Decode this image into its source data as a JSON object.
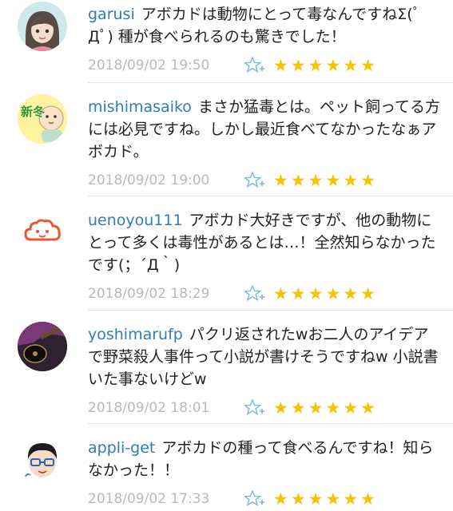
{
  "comments": [
    {
      "username": "garusi",
      "text": "アボカドは動物にとって毒なんですねΣ(ﾟДﾟ) 種が食べられるのも驚きでした！",
      "date": "2018/09/02 19:50",
      "stars": "★★★★★★"
    },
    {
      "username": "mishimasaiko",
      "text": "まさか猛毒とは。ペット飼ってる方には必見ですね。しかし最近食べてなかったなぁアボカド。",
      "date": "2018/09/02 19:00",
      "stars": "★★★★★★",
      "avatar_text": "新冬"
    },
    {
      "username": "uenoyou111",
      "text": "アボカド大好きですが、他の動物にとって多くは毒性があるとは…！全然知らなかったです(；´Д｀)",
      "date": "2018/09/02 18:29",
      "stars": "★★★★★★"
    },
    {
      "username": "yoshimarufp",
      "text": "パクリ返されたwお二人のアイデアで野菜殺人事件って小説が書けそうですねw 小説書いた事ないけどw",
      "date": "2018/09/02 18:01",
      "stars": "★★★★★★"
    },
    {
      "username": "appli-get",
      "text": "アボカドの種って食べるんですね！知らなかった！！",
      "date": "2018/09/02 17:33",
      "stars": "★★★★★★"
    }
  ]
}
